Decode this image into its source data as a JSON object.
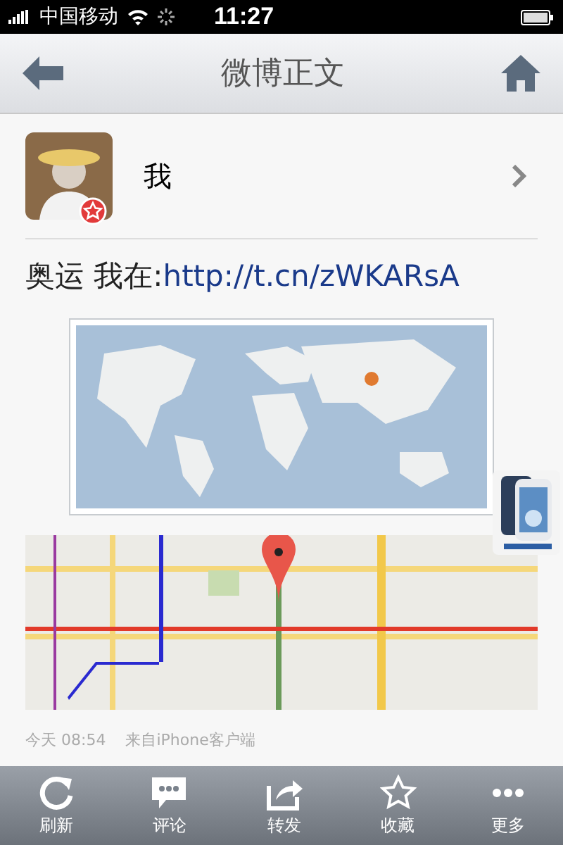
{
  "status_bar": {
    "carrier": "中国移动",
    "time": "11:27"
  },
  "nav_bar": {
    "title": "微博正文"
  },
  "author": {
    "name": "我"
  },
  "post": {
    "text": "奥运 我在:",
    "link": "http://t.cn/zWKARsA"
  },
  "meta": {
    "time": "今天 08:54",
    "source": "来自iPhone客户端"
  },
  "toolbar": [
    {
      "kind": "refresh",
      "label": "刷新"
    },
    {
      "kind": "comment",
      "label": "评论"
    },
    {
      "kind": "forward",
      "label": "转发"
    },
    {
      "kind": "favorite",
      "label": "收藏"
    },
    {
      "kind": "more",
      "label": "更多"
    }
  ]
}
